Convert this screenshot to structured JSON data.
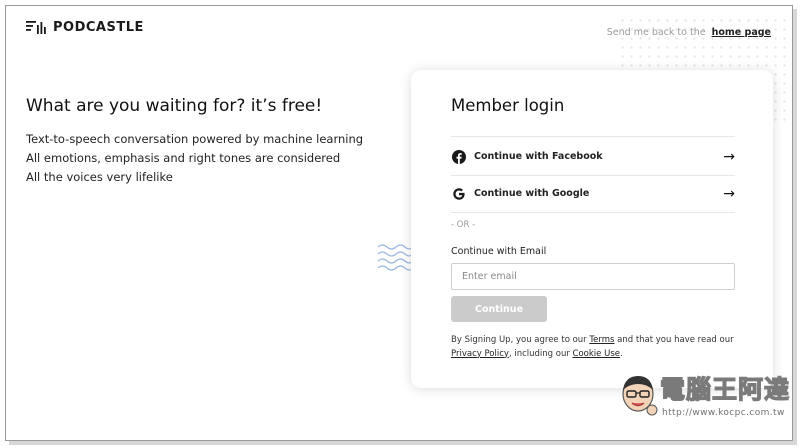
{
  "brand": {
    "name": "PODCASTLE"
  },
  "header": {
    "back_text": "Send me back to the",
    "home_link": "home page"
  },
  "hero": {
    "headline": "What are you waiting for? it’s free!",
    "lines": [
      "Text-to-speech conversation powered by machine learning",
      "All emotions, emphasis and right tones are considered",
      "All the voices very lifelike"
    ]
  },
  "login": {
    "title": "Member login",
    "facebook_label": "Continue with Facebook",
    "google_label": "Continue with Google",
    "arrow": "→",
    "or_text": "- OR -",
    "email_label": "Continue with Email",
    "email_placeholder": "Enter email",
    "continue_label": "Continue",
    "terms": {
      "part1": "By Signing Up, you agree to our ",
      "terms_link": "Terms",
      "part2": " and that you have read our ",
      "privacy_link": "Privacy Policy",
      "part3": ", including our ",
      "cookie_link": "Cookie Use",
      "part4": "."
    }
  },
  "watermark": {
    "title": "電腦王阿達",
    "url": "http://www.kocpc.com.tw"
  },
  "icons": {
    "logo": "podcastle-logo-icon",
    "facebook": "facebook-icon",
    "google": "google-icon",
    "waves": "waves-icon"
  },
  "colors": {
    "facebook": "#1a1a1a",
    "button_disabled": "#cbcbcb",
    "wave": "#9bb8e0"
  }
}
